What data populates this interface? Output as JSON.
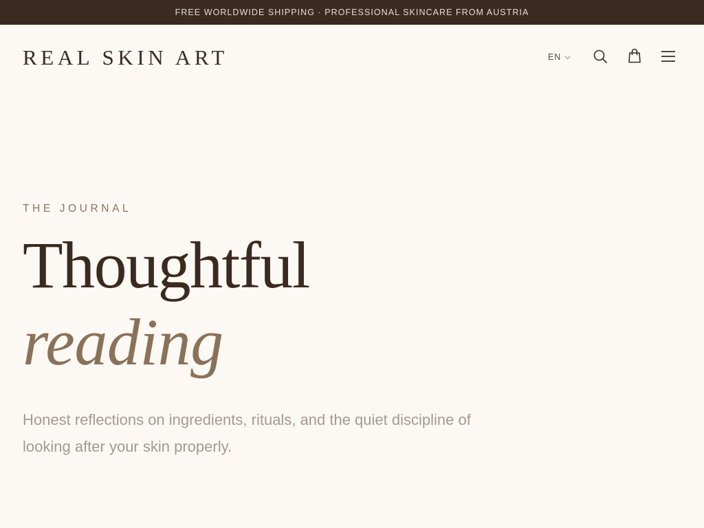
{
  "announcement": {
    "text": "FREE WORLDWIDE SHIPPING · PROFESSIONAL SKINCARE FROM AUSTRIA"
  },
  "header": {
    "logo": "REAL SKIN ART",
    "language": "EN",
    "icons": {
      "language_chevron": "chevron-down-icon",
      "search": "search-icon",
      "cart": "shopping-bag-icon",
      "menu": "hamburger-menu-icon"
    }
  },
  "hero": {
    "eyebrow": "THE JOURNAL",
    "title_line1": "Thoughtful",
    "title_line2": "reading",
    "intro": "Honest reflections on ingredients, rituals, and the quiet discipline of looking after your skin properly."
  },
  "colors": {
    "background": "#fcf9f5",
    "announcement_bg": "#3b2a1f",
    "announcement_text": "#e7dccf",
    "primary_text": "#3b2a1f",
    "accent": "#8a7259",
    "muted_text": "#a59990"
  }
}
